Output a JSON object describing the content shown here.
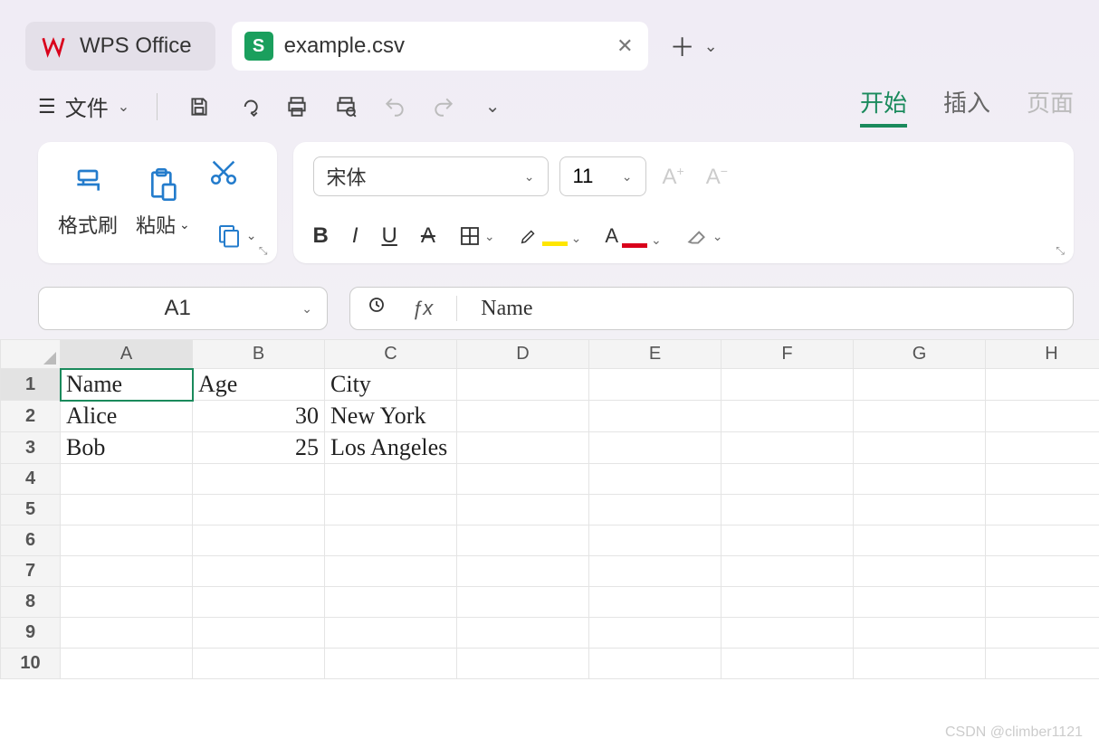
{
  "app": {
    "name": "WPS Office"
  },
  "tab": {
    "title": "example.csv",
    "icon_letter": "S"
  },
  "menu": {
    "file_label": "文件"
  },
  "ribbon_tabs": {
    "start": "开始",
    "insert": "插入",
    "page": "页面"
  },
  "clipboard": {
    "format_painter": "格式刷",
    "paste": "粘贴"
  },
  "font": {
    "family": "宋体",
    "size": "11"
  },
  "name_box": {
    "value": "A1"
  },
  "formula": {
    "value": "Name"
  },
  "columns": [
    "A",
    "B",
    "C",
    "D",
    "E",
    "F",
    "G",
    "H"
  ],
  "row_count": 10,
  "cells": {
    "1": {
      "A": "Name",
      "B": "Age",
      "C": "City"
    },
    "2": {
      "A": "Alice",
      "B": "30",
      "C": "New York"
    },
    "3": {
      "A": "Bob",
      "B": "25",
      "C": "Los Angeles"
    }
  },
  "numeric_cols_in_rows": {
    "2": [
      "B"
    ],
    "3": [
      "B"
    ]
  },
  "active_cell": "A1",
  "watermark": "CSDN @climber1121"
}
